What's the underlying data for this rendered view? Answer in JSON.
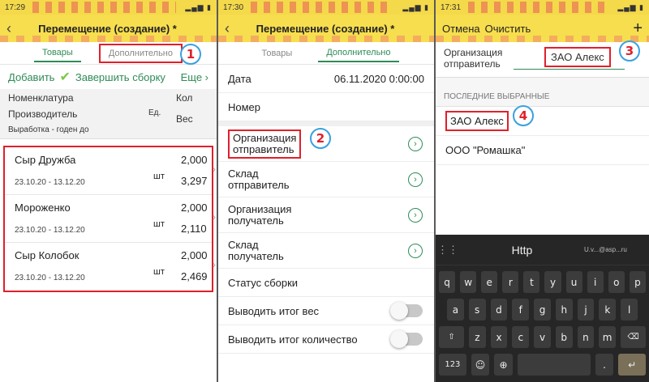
{
  "panel1": {
    "time": "17:29",
    "title": "Перемещение (создание) *",
    "tabs": [
      "Товары",
      "Дополнительно"
    ],
    "badge": "1",
    "actions": {
      "add": "Добавить",
      "finish": "Завершить сборку",
      "more": "Еще"
    },
    "header": {
      "nom": "Номенклатура",
      "prod": "Производитель",
      "unit": "Ед.",
      "qty": "Кол",
      "weight": "Вес",
      "output": "Выработка - годен до"
    },
    "items": [
      {
        "name": "Сыр Дружба",
        "dates": "23.10.20 - 13.12.20",
        "unit": "шт",
        "qty": "2,000",
        "weight": "3,297"
      },
      {
        "name": "Мороженко",
        "dates": "23.10.20 - 13.12.20",
        "unit": "шт",
        "qty": "2,000",
        "weight": "2,110"
      },
      {
        "name": "Сыр Колобок",
        "dates": "23.10.20 - 13.12.20",
        "unit": "шт",
        "qty": "2,000",
        "weight": "2,469"
      }
    ]
  },
  "panel2": {
    "time": "17:30",
    "title": "Перемещение (создание) *",
    "tabs": [
      "Товары",
      "Дополнительно"
    ],
    "badge": "2",
    "date_label": "Дата",
    "date_value": "06.11.2020  0:00:00",
    "number_label": "Номер",
    "fields": [
      "Организация\nотправитель",
      "Склад\nотправитель",
      "Организация\nполучатель",
      "Склад\nполучатель"
    ],
    "status_label": "Статус сборки",
    "toggles": [
      "Выводить итог вес",
      "Выводить итог количество"
    ]
  },
  "panel3": {
    "time": "17:31",
    "cancel": "Отмена",
    "clear": "Очистить",
    "plus": "+",
    "org_label": "Организация\nотправитель",
    "org_value": "ЗАО Алекс",
    "badge3": "3",
    "recent_header": "ПОСЛЕДНИЕ ВЫБРАННЫЕ",
    "recent": [
      "ЗАО Алекс",
      "ООО \"Ромашка\""
    ],
    "badge4": "4",
    "kbd_suggest": "Http",
    "kbd_email": "U.v...@asp...ru",
    "kbd_rows": [
      [
        "q",
        "w",
        "e",
        "r",
        "t",
        "y",
        "u",
        "i",
        "o",
        "p"
      ],
      [
        "a",
        "s",
        "d",
        "f",
        "g",
        "h",
        "j",
        "k",
        "l"
      ],
      [
        "z",
        "x",
        "c",
        "v",
        "b",
        "n",
        "m"
      ]
    ],
    "kbd_num": "123"
  }
}
